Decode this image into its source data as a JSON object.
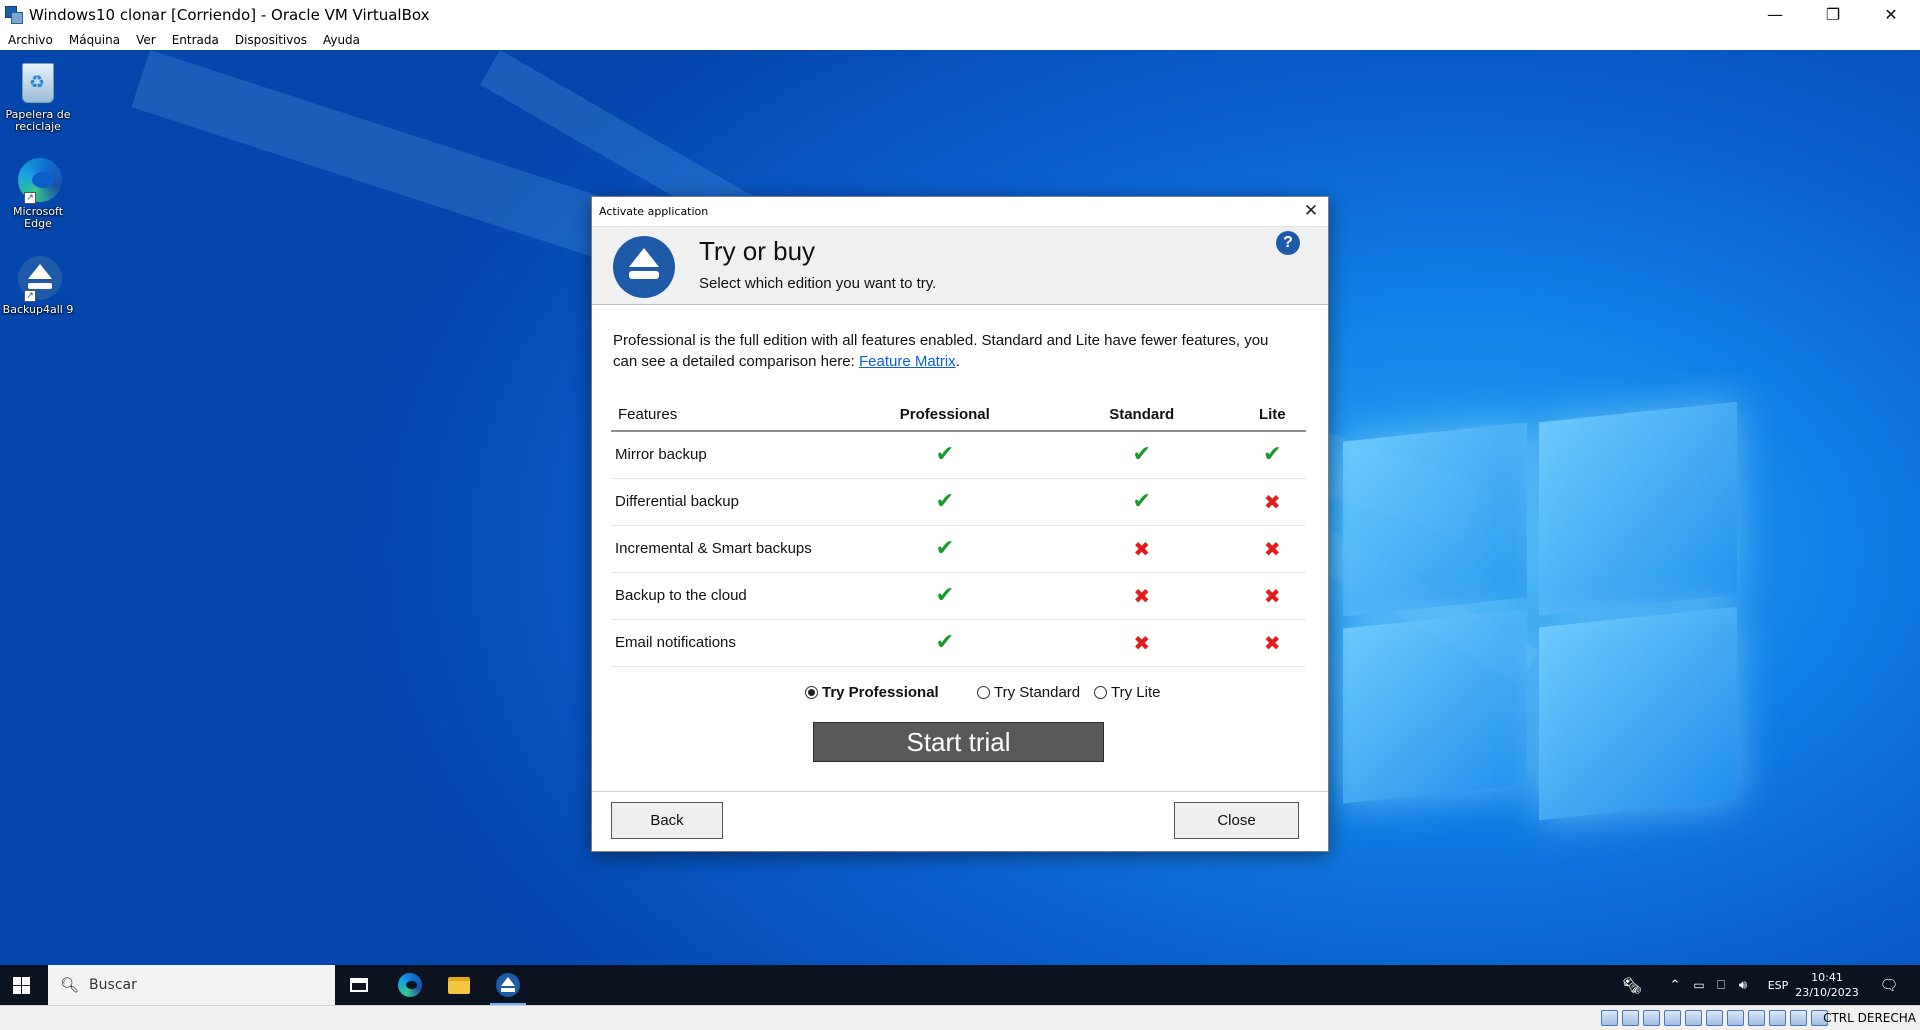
{
  "vbox": {
    "title": "Windows10  clonar [Corriendo] - Oracle VM VirtualBox",
    "menu": [
      "Archivo",
      "Máquina",
      "Ver",
      "Entrada",
      "Dispositivos",
      "Ayuda"
    ],
    "host_key": "CTRL DERECHA"
  },
  "desktop": {
    "icons": [
      {
        "label": "Papelera de reciclaje",
        "icon": "recycle-bin-icon"
      },
      {
        "label": "Microsoft Edge",
        "icon": "edge-icon"
      },
      {
        "label": "Backup4all 9",
        "icon": "backup4all-icon"
      }
    ]
  },
  "dialog": {
    "window_title": "Activate application",
    "header_title": "Try or buy",
    "header_subtitle": "Select which edition you want to try.",
    "intro_text": "Professional is the full edition with all features enabled. Standard and Lite have fewer features, you can see a detailed comparison here: ",
    "intro_link": "Feature Matrix",
    "intro_end": ".",
    "table": {
      "headers": [
        "Features",
        "Professional",
        "Standard",
        "Lite"
      ],
      "rows": [
        {
          "feature": "Mirror backup",
          "professional": true,
          "standard": true,
          "lite": true
        },
        {
          "feature": "Differential backup",
          "professional": true,
          "standard": true,
          "lite": false
        },
        {
          "feature": "Incremental & Smart backups",
          "professional": true,
          "standard": false,
          "lite": false
        },
        {
          "feature": "Backup to the cloud",
          "professional": true,
          "standard": false,
          "lite": false
        },
        {
          "feature": "Email notifications",
          "professional": true,
          "standard": false,
          "lite": false
        }
      ]
    },
    "radios": [
      {
        "label": "Try Professional",
        "selected": true
      },
      {
        "label": "Try Standard",
        "selected": false
      },
      {
        "label": "Try Lite",
        "selected": false
      }
    ],
    "start_trial_label": "Start trial",
    "back_label": "Back",
    "close_label": "Close",
    "check_glyph": "✔",
    "cross_glyph": "✖"
  },
  "taskbar": {
    "search_placeholder": "Buscar",
    "language": "ESP",
    "time": "10:41",
    "date": "23/10/2023"
  },
  "colors": {
    "check": "#1a9a2e",
    "cross": "#e11d1d",
    "brand": "#1e5aa8",
    "link": "#0a60d8"
  }
}
